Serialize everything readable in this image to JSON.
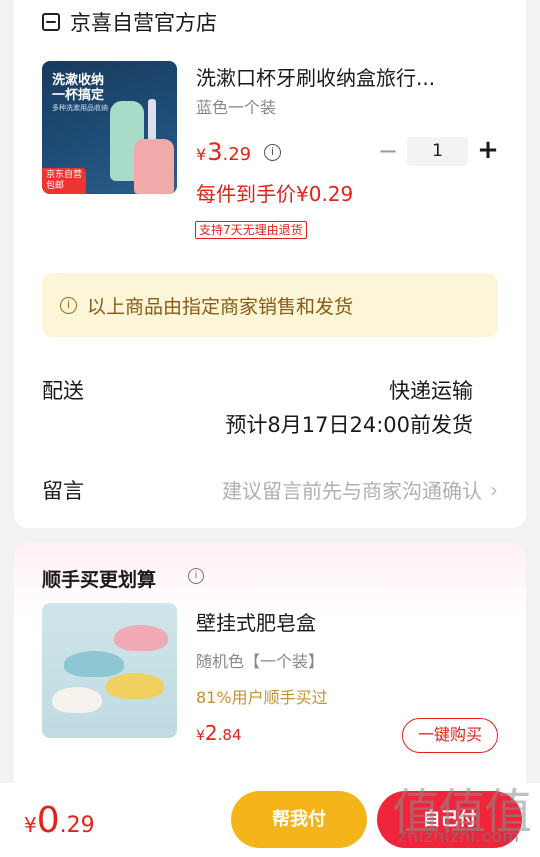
{
  "store": {
    "name": "京喜自营官方店",
    "icon": "store-icon"
  },
  "product": {
    "image": {
      "title_line1": "洗漱收纳",
      "title_line2": "一杯搞定",
      "subtitle": "多种洗漱用品收纳",
      "tag_line1": "京东自营",
      "tag_line2": "包邮"
    },
    "title": "洗漱口杯牙刷收纳盒旅行...",
    "spec": "蓝色一个装",
    "price_currency": "¥",
    "price_int": "3",
    "price_dec": ".29",
    "quantity": "1",
    "final_price": "每件到手价¥0.29",
    "return_tag": "支持7天无理由退货"
  },
  "notice": {
    "text": "以上商品由指定商家销售和发货"
  },
  "delivery": {
    "label": "配送",
    "method": "快递运输",
    "time": "预计8月17日24:00前发货"
  },
  "message": {
    "label": "留言",
    "placeholder": "建议留言前先与商家沟通确认"
  },
  "recommend": {
    "section_title": "顺手买更划算",
    "item": {
      "title": "壁挂式肥皂盒",
      "spec": "随机色【一个装】",
      "stat": "81%用户顺手买过",
      "price_currency": "¥",
      "price_int": "2",
      "price_dec": ".84",
      "buy_label": "一键购买"
    }
  },
  "bottom_bar": {
    "total_currency": "¥",
    "total_int": "0",
    "total_dec": ".29",
    "help_pay_label": "帮我付",
    "self_pay_label": "自己付"
  },
  "watermark": {
    "logo": "值值值",
    "url": "zhizhizhi.com"
  },
  "colors": {
    "accent": "#e2231a",
    "help_button": "#f5b419",
    "self_button": "#f0243a",
    "notice_bg": "#fdf5d8"
  }
}
